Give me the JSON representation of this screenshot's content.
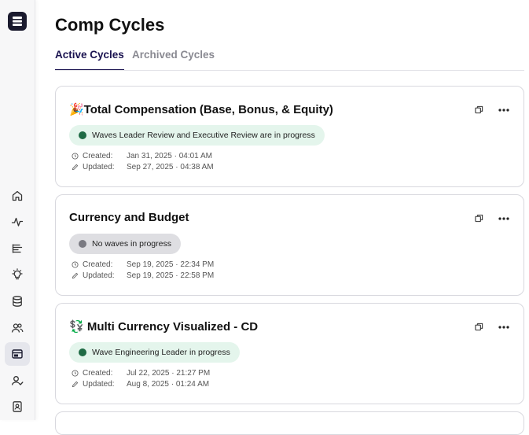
{
  "page": {
    "title": "Comp Cycles"
  },
  "tabs": [
    {
      "label": "Active Cycles",
      "active": true
    },
    {
      "label": "Archived Cycles",
      "active": false
    }
  ],
  "sidebar": {
    "items": [
      {
        "name": "home",
        "icon": "home-icon"
      },
      {
        "name": "activity",
        "icon": "pulse-icon"
      },
      {
        "name": "reports",
        "icon": "list-icon"
      },
      {
        "name": "insights",
        "icon": "lightbulb-icon"
      },
      {
        "name": "database",
        "icon": "database-icon"
      },
      {
        "name": "people",
        "icon": "users-icon"
      },
      {
        "name": "comp-cycles",
        "icon": "layout-icon",
        "active": true
      },
      {
        "name": "profile",
        "icon": "user-check-icon"
      },
      {
        "name": "directory",
        "icon": "contact-card-icon"
      }
    ]
  },
  "cycles": [
    {
      "title": "🎉Total Compensation (Base, Bonus, & Equity)",
      "status": "Waves Leader Review and Executive Review are in progress",
      "status_color": "green",
      "created_label": "Created:",
      "created": "Jan 31, 2025 · 04:01 AM",
      "updated_label": "Updated:",
      "updated": "Sep 27, 2025 · 04:38 AM"
    },
    {
      "title": "Currency and Budget",
      "status": "No waves in progress",
      "status_color": "gray",
      "created_label": "Created:",
      "created": "Sep 19, 2025 · 22:34 PM",
      "updated_label": "Updated:",
      "updated": "Sep 19, 2025 · 22:58 PM"
    },
    {
      "title": "💱 Multi Currency Visualized - CD",
      "status": "Wave Engineering Leader in progress",
      "status_color": "green",
      "created_label": "Created:",
      "created": "Jul 22, 2025 · 21:27 PM",
      "updated_label": "Updated:",
      "updated": "Aug 8, 2025 · 01:24 AM"
    }
  ],
  "colors": {
    "accent": "#1a1350",
    "badge_green": "#e4f5ec",
    "dot_green": "#1f6b45",
    "badge_gray": "#dedee2"
  }
}
